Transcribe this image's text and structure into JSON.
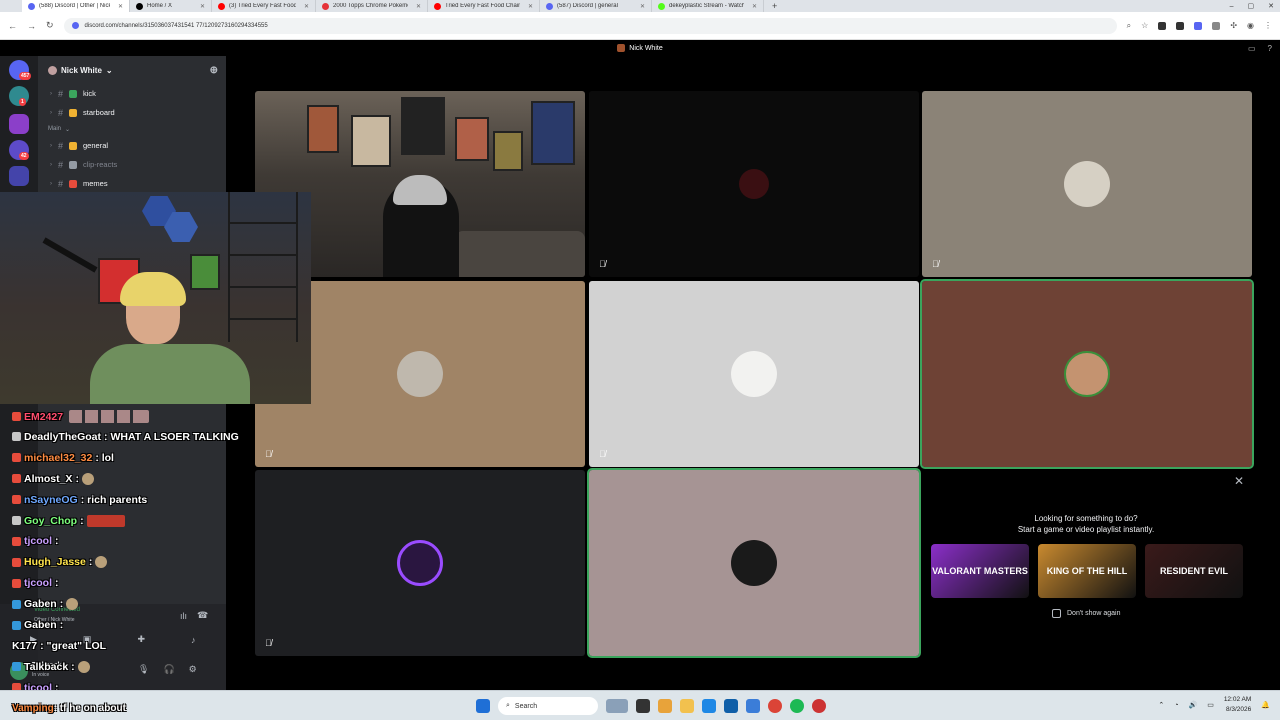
{
  "browser": {
    "tabs": [
      {
        "label": "(588) Discord | Other | Nick White",
        "active": true,
        "color": "#5865f2"
      },
      {
        "label": "Home / X",
        "active": false,
        "color": "#000000"
      },
      {
        "label": "(3) Tried Every Fast Food Chain",
        "active": false,
        "color": "#ff0000"
      },
      {
        "label": "2000 Topps Chrome Pokemon",
        "active": false,
        "color": "#e53238"
      },
      {
        "label": "Tried Every Fast Food Chain",
        "active": false,
        "color": "#ff0000"
      },
      {
        "label": "(587) Discord | general",
        "active": false,
        "color": "#5865f2"
      },
      {
        "label": "dekeyplastic Stream - Watch Live",
        "active": false,
        "color": "#53fc18"
      }
    ],
    "url": "discord.com/channels/315036037431541 77/1209273160294334555"
  },
  "discord": {
    "call_title": "Nick White",
    "server_name": "Nick White",
    "rail_badges": [
      "457",
      "1",
      "42"
    ],
    "channels_top": [
      {
        "name": "kick",
        "emoji_color": "#3ba55d",
        "dim": false
      },
      {
        "name": "starboard",
        "emoji_color": "#f0b232",
        "dim": false
      }
    ],
    "category": "Main",
    "channels_main": [
      {
        "name": "general",
        "emoji_color": "#f0b232",
        "dim": false
      },
      {
        "name": "clip-reacts",
        "emoji_color": "#949ba4",
        "dim": true
      },
      {
        "name": "memes",
        "emoji_color": "#e74c3c",
        "dim": false
      }
    ],
    "voice_panel": {
      "status": "Video Connected",
      "channel": "Other / Nick White"
    },
    "user_panel": {
      "name": "Talkback",
      "status": "In voice"
    }
  },
  "chat": [
    {
      "user": "EM2427",
      "message": "",
      "user_color": "#ff4d6d",
      "badge": "red",
      "emote": "faces"
    },
    {
      "user": "DeadlyTheGoat",
      "message": ": WHAT A LSOER TALKING",
      "user_color": "#ffffff",
      "badge": "grey"
    },
    {
      "user": "michael32_32",
      "message": ": lol",
      "user_color": "#ff8c42",
      "badge": "red"
    },
    {
      "user": "Almost_X",
      "message": ":",
      "user_color": "#ffffff",
      "badge": "red",
      "emote": "small"
    },
    {
      "user": "nSayneOG",
      "message": ": rich parents",
      "user_color": "#6fa8ff",
      "badge": "red"
    },
    {
      "user": "Goy_Chop",
      "message": ":",
      "user_color": "#7dff7d",
      "badge": "grey",
      "emote": "wide"
    },
    {
      "user": "tjcool",
      "message": ":",
      "user_color": "#c9a0ff",
      "badge": "red"
    },
    {
      "user": "Hugh_Jasse",
      "message": ":",
      "user_color": "#ffe44d",
      "badge": "red",
      "emote": "small"
    },
    {
      "user": "tjcool",
      "message": ":",
      "user_color": "#c9a0ff",
      "badge": "red"
    },
    {
      "user": "Gaben",
      "message": ":",
      "user_color": "#ffffff",
      "badge": "blue",
      "emote": "small"
    },
    {
      "user": "Gaben",
      "message": ":",
      "user_color": "#ffffff",
      "badge": "blue"
    },
    {
      "user": "K177",
      "message": ": \"great\" LOL",
      "user_color": "#ffffff",
      "badge": "none"
    },
    {
      "user": "Talkback",
      "message": ":",
      "user_color": "#ffffff",
      "badge": "blue",
      "emote": "small"
    },
    {
      "user": "tjcool",
      "message": ":",
      "user_color": "#c9a0ff",
      "badge": "red"
    }
  ],
  "bottom_chat": {
    "user": "Vamping",
    "message": ": tf he on about"
  },
  "activity": {
    "title": "Looking for something to do?",
    "subtitle": "Start a game or video playlist instantly.",
    "cards": [
      {
        "label": "VALORANT MASTERS",
        "color": "#8b2fc9"
      },
      {
        "label": "KING OF THE HILL",
        "color": "#c98a2f"
      },
      {
        "label": "RESIDENT EVIL",
        "color": "#3a1a1a"
      }
    ],
    "dont_show": "Don't show again"
  },
  "taskbar": {
    "search_placeholder": "Search",
    "time": "12:02 AM",
    "date": "8/3/2026"
  },
  "colors": {
    "speaking": "#3ba55d",
    "discord_blurple": "#5865f2"
  }
}
